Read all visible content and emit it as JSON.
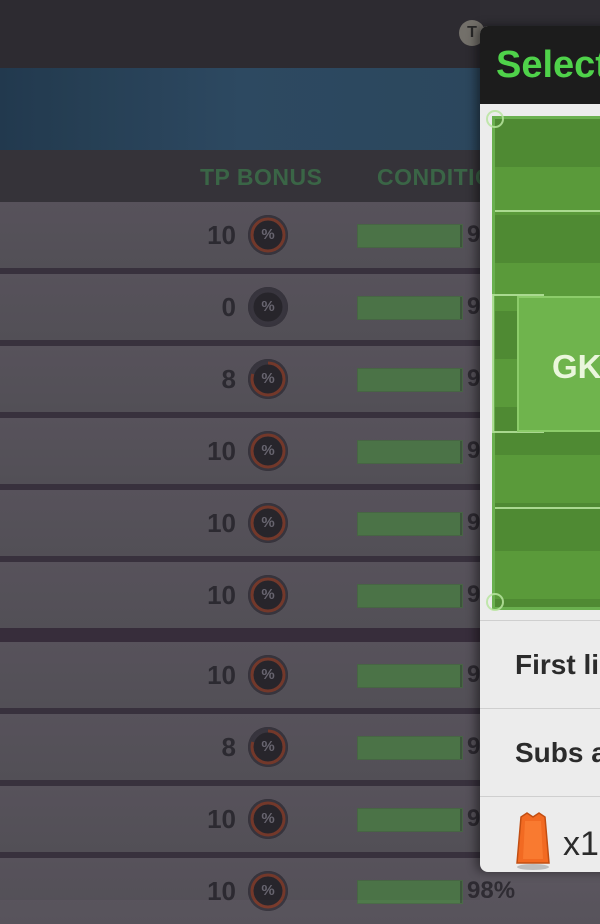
{
  "topbar": {
    "coin_label": "T"
  },
  "table": {
    "headers": {
      "tp_bonus": "TP BONUS",
      "condition": "CONDITIO"
    },
    "rows": [
      {
        "bonus": "10",
        "bonus_fraction": 1.0,
        "condition": "9",
        "condition_fraction": 0.98
      },
      {
        "bonus": "0",
        "bonus_fraction": 0.0,
        "condition": "9",
        "condition_fraction": 0.98
      },
      {
        "bonus": "8",
        "bonus_fraction": 0.8,
        "condition": "9",
        "condition_fraction": 0.98
      },
      {
        "bonus": "10",
        "bonus_fraction": 1.0,
        "condition": "9",
        "condition_fraction": 0.98
      },
      {
        "bonus": "10",
        "bonus_fraction": 1.0,
        "condition": "9",
        "condition_fraction": 0.98
      },
      {
        "bonus": "10",
        "bonus_fraction": 1.0,
        "condition": "9",
        "condition_fraction": 0.98
      },
      {
        "bonus": "10",
        "bonus_fraction": 1.0,
        "condition": "9",
        "condition_fraction": 0.98
      },
      {
        "bonus": "8",
        "bonus_fraction": 0.8,
        "condition": "9",
        "condition_fraction": 0.98
      },
      {
        "bonus": "10",
        "bonus_fraction": 1.0,
        "condition": "9",
        "condition_fraction": 0.98
      },
      {
        "bonus": "10",
        "bonus_fraction": 1.0,
        "condition": "98%",
        "condition_fraction": 0.98
      }
    ],
    "bonus_icon_symbol": "%"
  },
  "modal": {
    "title": "Select",
    "position_label": "GK",
    "menu": {
      "first_lineup": "First li",
      "subs": "Subs a",
      "bibs_count": "x1"
    }
  },
  "colors": {
    "accent_green": "#4fd24a",
    "header_green": "#3d6b4a",
    "bib_orange": "#f26a22"
  },
  "icons": [
    "tp-coin-icon",
    "percent-icon",
    "bib-icon"
  ]
}
